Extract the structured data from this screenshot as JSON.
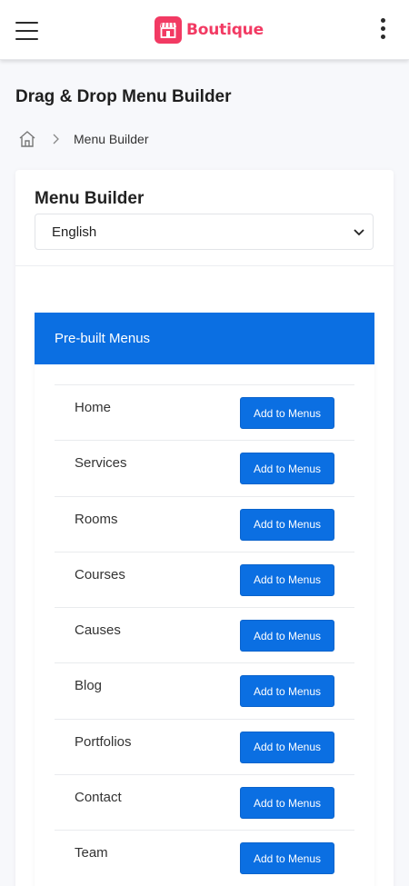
{
  "header": {
    "brand": "Boutique",
    "brand_color": "#f23a63",
    "menu_icon": "hamburger-icon",
    "more_icon": "kebab-icon",
    "logo_icon": "storefront-icon"
  },
  "page": {
    "title": "Drag & Drop Menu Builder"
  },
  "breadcrumb": {
    "home_icon": "home-icon",
    "current": "Menu Builder"
  },
  "card": {
    "title": "Menu Builder",
    "language": {
      "selected": "English"
    }
  },
  "panel": {
    "title": "Pre-built Menus",
    "accent": "#0b6fe2",
    "items": [
      {
        "label": "Home",
        "button": "Add to Menus"
      },
      {
        "label": "Services",
        "button": "Add to Menus"
      },
      {
        "label": "Rooms",
        "button": "Add to Menus"
      },
      {
        "label": "Courses",
        "button": "Add to Menus"
      },
      {
        "label": "Causes",
        "button": "Add to Menus"
      },
      {
        "label": "Blog",
        "button": "Add to Menus"
      },
      {
        "label": "Portfolios",
        "button": "Add to Menus"
      },
      {
        "label": "Contact",
        "button": "Add to Menus"
      },
      {
        "label": "Team",
        "button": "Add to Menus"
      }
    ]
  }
}
